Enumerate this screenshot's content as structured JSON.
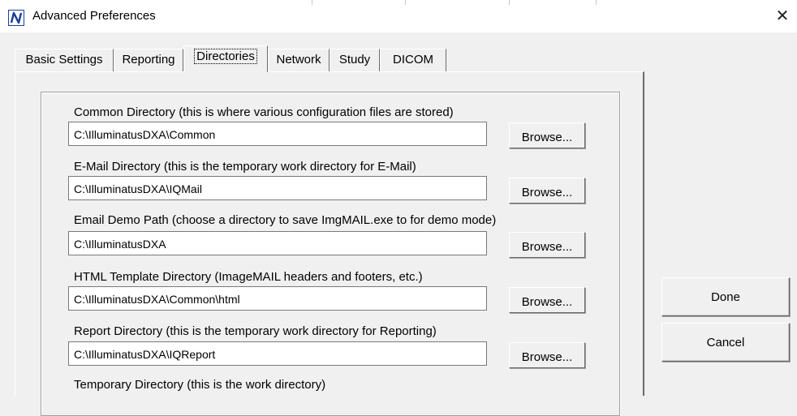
{
  "window": {
    "title": "Advanced Preferences",
    "app_icon": "N-logo-icon",
    "close_glyph": "✕"
  },
  "tabs": [
    {
      "label": "Basic Settings",
      "selected": false
    },
    {
      "label": "Reporting",
      "selected": false
    },
    {
      "label": "Directories",
      "selected": true
    },
    {
      "label": "Network",
      "selected": false
    },
    {
      "label": "Study",
      "selected": false
    },
    {
      "label": "DICOM",
      "selected": false
    }
  ],
  "fields": [
    {
      "label": "Common Directory (this is where various configuration files are stored)",
      "value": "C:\\IlluminatusDXA\\Common",
      "button": "Browse..."
    },
    {
      "label": "E-Mail Directory (this is the temporary work directory for E-Mail)",
      "value": "C:\\IlluminatusDXA\\IQMail",
      "button": "Browse..."
    },
    {
      "label": "Email Demo Path (choose a directory to save ImgMAIL.exe to for demo mode)",
      "value": "C:\\IlluminatusDXA",
      "button": "Browse..."
    },
    {
      "label": "HTML Template Directory (ImageMAIL headers and footers, etc.)",
      "value": "C:\\IlluminatusDXA\\Common\\html",
      "button": "Browse..."
    },
    {
      "label": "Report Directory (this is the temporary work directory for Reporting)",
      "value": "C:\\IlluminatusDXA\\IQReport",
      "button": "Browse..."
    },
    {
      "label": "Temporary Directory (this is the work directory)"
    }
  ],
  "buttons": {
    "done": "Done",
    "cancel": "Cancel"
  }
}
